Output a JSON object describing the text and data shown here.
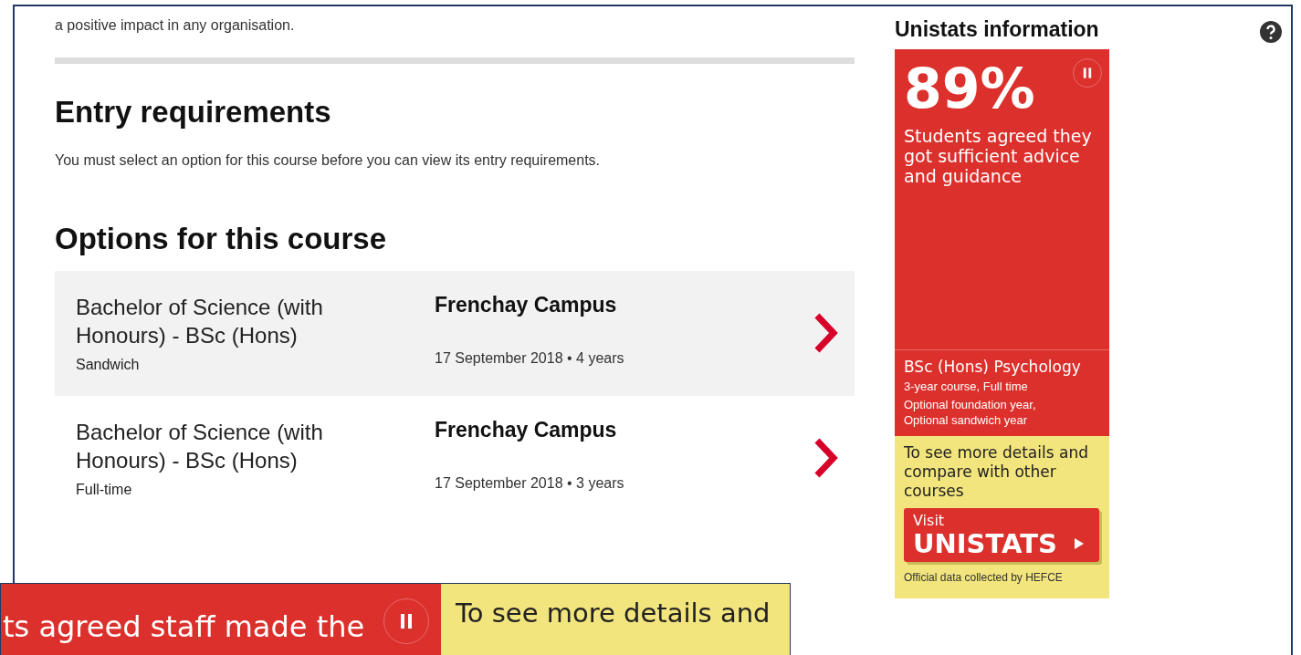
{
  "intro_text": "a positive impact in any organisation.",
  "entry_requirements": {
    "heading": "Entry requirements",
    "text": "You must select an option for this course before you can view its entry requirements."
  },
  "options": {
    "heading": "Options for this course",
    "items": [
      {
        "title": "Bachelor of Science (with Honours) - BSc (Hons)",
        "mode": "Sandwich",
        "campus": "Frenchay Campus",
        "details": "17 September 2018 • 4 years",
        "highlighted": true
      },
      {
        "title": "Bachelor of Science (with Honours) - BSc (Hons)",
        "mode": "Full-time",
        "campus": "Frenchay Campus",
        "details": "17 September 2018 • 3 years",
        "highlighted": false
      }
    ]
  },
  "unistats": {
    "heading": "Unistats information",
    "stat": "89%",
    "stat_text": "Students agreed they got sufficient advice and guidance",
    "course": "BSc (Hons) Psychology",
    "course_detail": "3-year course, Full time",
    "course_options": "Optional foundation year, Optional sandwich year",
    "compare_text": "To see more details and compare with other courses",
    "button_small": "Visit",
    "button_large": "UNISTATS",
    "footnote": "Official data collected by HEFCE"
  },
  "bottom_banner": {
    "stat_text": "ts agreed staff made the",
    "compare_text": "To see more details and"
  }
}
